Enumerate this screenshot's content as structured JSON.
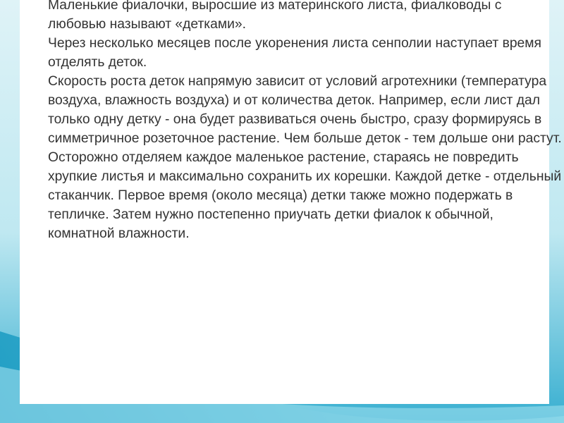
{
  "slide": {
    "paragraphs": [
      "Маленькие фиалочки, выросшие из материнского листа, фиалководы с любовью называют «детками».",
      "Через несколько месяцев после укоренения листа сенполии наступает время отделять деток.",
      "Скорость роста деток напрямую зависит от условий агротехники (температура воздуха, влажность воздуха) и от количества деток. Например, если лист дал только одну детку - она будет развиваться очень быстро, сразу формируясь в симметричное розеточное растение. Чем больше деток - тем дольше они растут.",
      "Осторожно отделяем каждое маленькое растение, стараясь не повредить хрупкие листья и максимально сохранить их корешки. Каждой детке - отдельный стаканчик. Первое время (около месяца) детки также можно подержать в тепличке. Затем нужно постепенно приучать детки фиалок к обычной, комнатной влажности."
    ]
  },
  "theme": {
    "background_light": "#dff3f7",
    "background_mid": "#8fd3e6",
    "background_dark": "#1d9fc4",
    "text_color": "#333333"
  }
}
